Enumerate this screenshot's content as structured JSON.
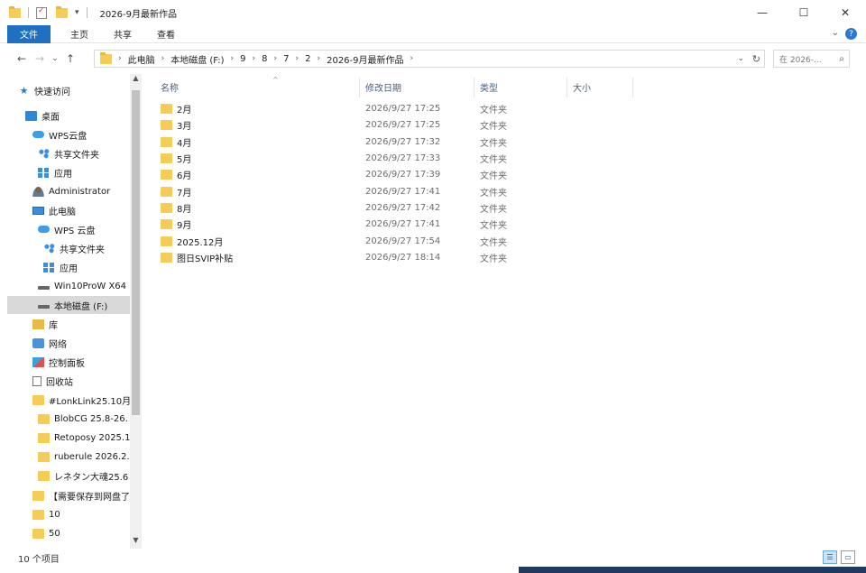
{
  "window": {
    "title": "2026-9月最新作品",
    "controls": {
      "minimize": "—",
      "maximize": "☐",
      "close": "✕"
    }
  },
  "ribbon": {
    "tabs": [
      "文件",
      "主页",
      "共享",
      "查看"
    ]
  },
  "address": {
    "crumbs": [
      "此电脑",
      "本地磁盘 (F:)",
      "9",
      "8",
      "7",
      "2",
      "2026-9月最新作品"
    ],
    "search_placeholder": "在 2026-..."
  },
  "nav": {
    "items": [
      {
        "label": "快速访问",
        "icon": "star-icon"
      },
      {
        "label": "桌面",
        "icon": "desktop-icon"
      },
      {
        "label": "WPS云盘",
        "icon": "cloud-icon"
      },
      {
        "label": "共享文件夹",
        "icon": "share-icon"
      },
      {
        "label": "应用",
        "icon": "apps-icon"
      },
      {
        "label": "Administrator",
        "icon": "user-icon"
      },
      {
        "label": "此电脑",
        "icon": "pc-icon"
      },
      {
        "label": "WPS 云盘",
        "icon": "cloud-icon"
      },
      {
        "label": "共享文件夹",
        "icon": "share-icon"
      },
      {
        "label": "应用",
        "icon": "apps-icon"
      },
      {
        "label": "Win10ProW X64",
        "icon": "drive-icon"
      },
      {
        "label": "本地磁盘 (F:)",
        "icon": "drive-icon",
        "selected": true
      },
      {
        "label": "库",
        "icon": "library-icon"
      },
      {
        "label": "网络",
        "icon": "network-icon"
      },
      {
        "label": "控制面板",
        "icon": "control-panel-icon"
      },
      {
        "label": "回收站",
        "icon": "recycle-bin-icon"
      },
      {
        "label": "#LonkLink25.10月",
        "icon": "folder-icon"
      },
      {
        "label": "BlobCG 25.8-26.",
        "icon": "folder-icon"
      },
      {
        "label": "Retoposy 2025.1",
        "icon": "folder-icon"
      },
      {
        "label": "ruberule 2026.2.",
        "icon": "folder-icon"
      },
      {
        "label": "レネタン大魂25.6",
        "icon": "folder-icon"
      },
      {
        "label": "【需要保存到网盘了",
        "icon": "folder-icon"
      },
      {
        "label": "10",
        "icon": "folder-icon"
      },
      {
        "label": "50",
        "icon": "folder-icon"
      }
    ]
  },
  "columns": {
    "name": "名称",
    "date": "修改日期",
    "type": "类型",
    "size": "大小"
  },
  "files": [
    {
      "name": "2月",
      "date": "2026/9/27 17:25",
      "type": "文件夹"
    },
    {
      "name": "3月",
      "date": "2026/9/27 17:25",
      "type": "文件夹"
    },
    {
      "name": "4月",
      "date": "2026/9/27 17:32",
      "type": "文件夹"
    },
    {
      "name": "5月",
      "date": "2026/9/27 17:33",
      "type": "文件夹"
    },
    {
      "name": "6月",
      "date": "2026/9/27 17:39",
      "type": "文件夹"
    },
    {
      "name": "7月",
      "date": "2026/9/27 17:41",
      "type": "文件夹"
    },
    {
      "name": "8月",
      "date": "2026/9/27 17:42",
      "type": "文件夹"
    },
    {
      "name": "9月",
      "date": "2026/9/27 17:41",
      "type": "文件夹"
    },
    {
      "name": "2025.12月",
      "date": "2026/9/27 17:54",
      "type": "文件夹"
    },
    {
      "name": "图日SVIP补贴",
      "date": "2026/9/27 18:14",
      "type": "文件夹"
    }
  ],
  "status": {
    "count": "10 个项目"
  },
  "colors": {
    "accent": "#1f6fc2",
    "folder": "#f5cc55",
    "selected_bg": "#d9d9d9"
  }
}
